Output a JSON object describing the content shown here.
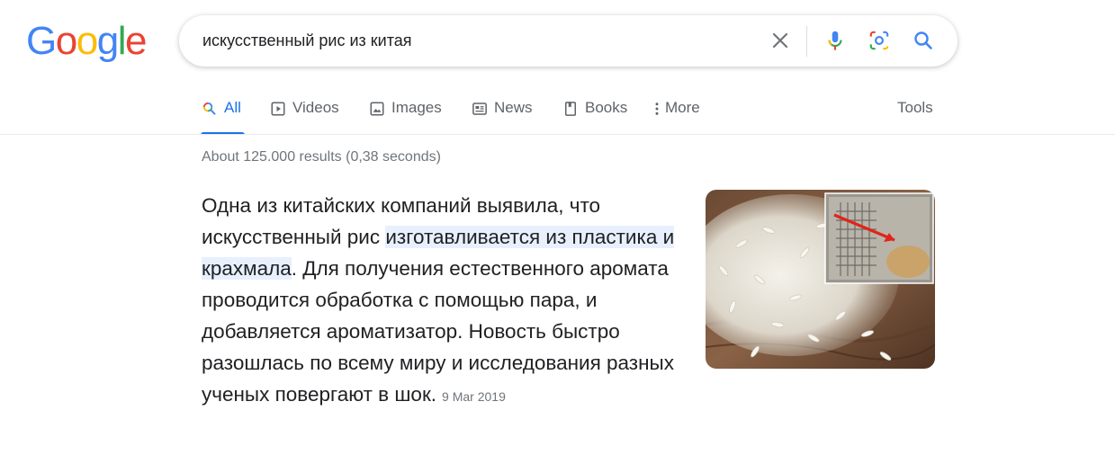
{
  "logo": {
    "letters": [
      "G",
      "o",
      "o",
      "g",
      "l",
      "e"
    ],
    "colors": [
      "#4285f4",
      "#ea4335",
      "#fbbc05",
      "#4285f4",
      "#34a853",
      "#ea4335"
    ]
  },
  "search": {
    "query": "искусственный рис из китая",
    "icons": [
      "close-icon",
      "mic-icon",
      "lens-icon",
      "search-icon"
    ]
  },
  "tabs": [
    {
      "label": "All",
      "icon": "search-icon",
      "active": true
    },
    {
      "label": "Videos",
      "icon": "video-icon"
    },
    {
      "label": "Images",
      "icon": "image-icon"
    },
    {
      "label": "News",
      "icon": "news-icon"
    },
    {
      "label": "Books",
      "icon": "book-icon"
    },
    {
      "label": "More",
      "icon": "more-vert-icon"
    }
  ],
  "tools_label": "Tools",
  "result_stats": "About 125.000 results (0,38 seconds)",
  "featured_snippet": {
    "text_before": "Одна из китайских компаний выявила, что искусственный рис ",
    "highlight": "изготавливается из пластика и крахмала",
    "text_after": ". Для получения естественного аромата проводится обработка с помощью пара, и добавляется ароматизатор. Новость быстро разошлась по всему миру и исследования разных ученых повергают в шок.",
    "date": "9 Mar 2019",
    "image": "rice-photo"
  },
  "colors": {
    "accent": "#1a73e8",
    "highlight_bg": "#e8f0fe"
  }
}
